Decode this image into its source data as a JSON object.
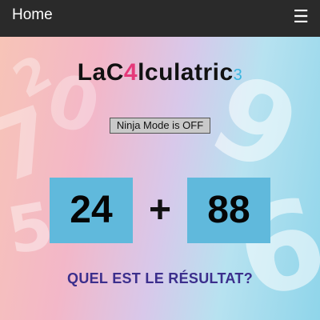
{
  "header": {
    "home_label": "Home",
    "menu_icon": "☰"
  },
  "title": {
    "part1": "LaC",
    "part2": "4",
    "part3": "lculatric",
    "part4": "3"
  },
  "ninja_button": {
    "label": "Ninja Mode is OFF"
  },
  "equation": {
    "left": "24",
    "operator": "+",
    "right": "88"
  },
  "prompt": "QUEL EST LE RÉSULTAT?",
  "colors": {
    "topbar": "#2a2a2a",
    "number_box": "#60b9dc",
    "title_accent_pink": "#e5397a",
    "title_accent_blue": "#3ab6e0",
    "prompt": "#3b2e8c"
  }
}
